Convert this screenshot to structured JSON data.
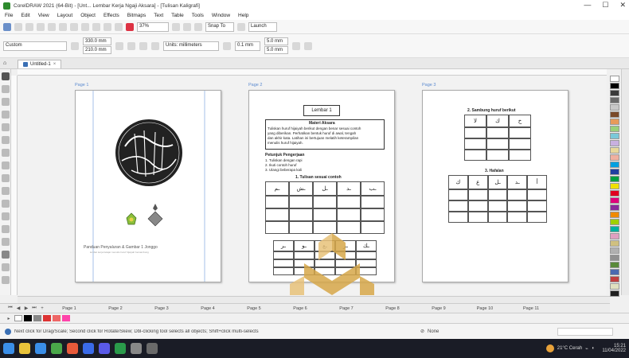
{
  "window": {
    "title": "CorelDRAW 2021 (64-Bit) - [Unt... Lembar Kerja Ngaji Aksara] - [Tulisan Kaligrafi]",
    "controls": [
      "—",
      "☐",
      "✕"
    ]
  },
  "menu": [
    "File",
    "Edit",
    "View",
    "Layout",
    "Object",
    "Effects",
    "Bitmaps",
    "Text",
    "Table",
    "Tools",
    "Window",
    "Help"
  ],
  "toolbar": {
    "zoom": "37%",
    "snap_label": "Snap To",
    "launch_label": "Launch"
  },
  "property_bar": {
    "preset": "Custom",
    "width": "330.0 mm",
    "height": "210.0 mm",
    "units": "Units: millimeters",
    "nudge": "0.1 mm",
    "dup_x": "5.0 mm",
    "dup_y": "5.0 mm"
  },
  "doc_tab": {
    "label": "Untitled-1"
  },
  "pages": {
    "p1": {
      "label": "Page 1",
      "caption": "Panduan Penyaluran & Gambar 1 Jonggo",
      "subcaption": "lembar kerja belajar menulis huruf hijaiyah bersambung"
    },
    "p2": {
      "label": "Page 2",
      "title": "Lembar 1",
      "sec1_head": "Materi Aksara",
      "sec1_text": [
        "Tuliskan huruf hijaiyah berikut dengan benar sesuai contoh",
        "yang diberikan. Perhatikan bentuk huruf di awal, tengah",
        "dan akhir kata. Latihan ini bertujuan melatih keterampilan",
        "menulis huruf hijaiyah."
      ],
      "sec2_head": "Petunjuk Pengerjaan",
      "sec2_text": [
        "1. Tuliskan dengan rapi",
        "2. Ikuti contoh huruf",
        "3. Ulangi beberapa kali"
      ],
      "table1_head": "1. Tulisan sesuai contoh",
      "table1_letters": [
        "ـم",
        "ـش",
        "ـل",
        "ـد",
        "ـب"
      ],
      "table2_letters": [
        "ـر",
        "ـو",
        "ـع",
        "ـر",
        "ـك"
      ]
    },
    "p3": {
      "label": "Page 3",
      "table1_head": "2. Sambung huruf berikut",
      "table1_letters": [
        "لا",
        "ك",
        "خ"
      ],
      "table2_head": "3. Hafalan",
      "table2_letters": [
        "ك",
        "ع",
        "ـل",
        "ـد",
        "أ"
      ]
    }
  },
  "page_tabs": [
    "Page 1",
    "Page 2",
    "Page 3",
    "Page 4",
    "Page 5",
    "Page 6",
    "Page 7",
    "Page 8",
    "Page 9",
    "Page 10",
    "Page 11"
  ],
  "status": {
    "text": "Next click for Drag/Scale; Second click for Rotate/Skew; Dbl-clicking tool selects all objects; Shift+click multi-selects",
    "fill": "None"
  },
  "tray": {
    "weather": "21°C Cerah",
    "time": "15:21",
    "date": "11/04/2022"
  },
  "colors": {
    "accent": "#3a6fb4",
    "taskbar": "#1a1c26",
    "watermark": "#d7a84a"
  }
}
